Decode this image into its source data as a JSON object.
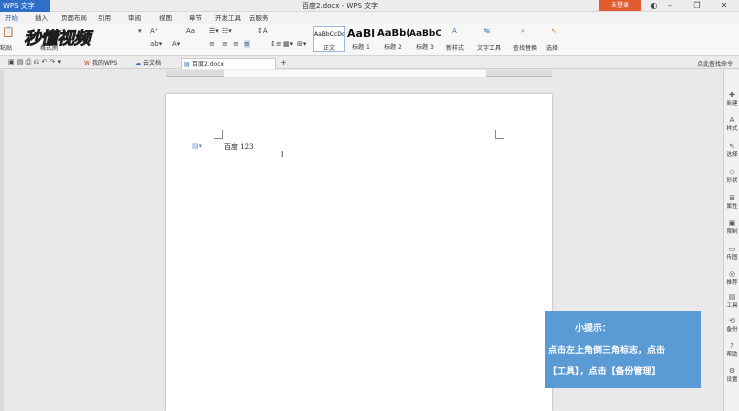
{
  "app": {
    "name": "WPS 文字",
    "doc_title": "百度2.docx - WPS 文字",
    "login": "未登录"
  },
  "menu": [
    "开始",
    "插入",
    "页面布局",
    "引用",
    "审阅",
    "视图",
    "章节",
    "开发工具",
    "云服务"
  ],
  "ribbon": {
    "paste": "粘贴",
    "format_painter": "格式刷",
    "styles": [
      {
        "sample": "AaBbCcDd",
        "caption": "正文"
      },
      {
        "sample": "AaBl",
        "caption": "标题 1"
      },
      {
        "sample": "AaBb(",
        "caption": "标题 2"
      },
      {
        "sample": "AaBbC",
        "caption": "标题 3"
      }
    ],
    "new_style": "新样式",
    "text_tools": "文字工具",
    "find_replace": "查找替换",
    "select": "选择"
  },
  "watermark": "秒懂视频",
  "tabs": {
    "my_wps": "我的WPS",
    "cloud_docs": "云文档",
    "current": "百度2.docx",
    "hint": "点此查找命令"
  },
  "document": {
    "text": "百度 123"
  },
  "right_panel": [
    "新建",
    "样式",
    "选择",
    "形状",
    "属性",
    "限制",
    "传图",
    "推荐",
    "工具",
    "备份",
    "帮助",
    "设置"
  ],
  "tip": {
    "title": "小提示：",
    "line1": "点击左上角倒三角标志，点击",
    "line2": "【工具】，点击【备份管理】"
  },
  "colors": {
    "accent": "#2b64b8",
    "tip_bg": "#5b9bd5",
    "login": "#e05b2f"
  }
}
